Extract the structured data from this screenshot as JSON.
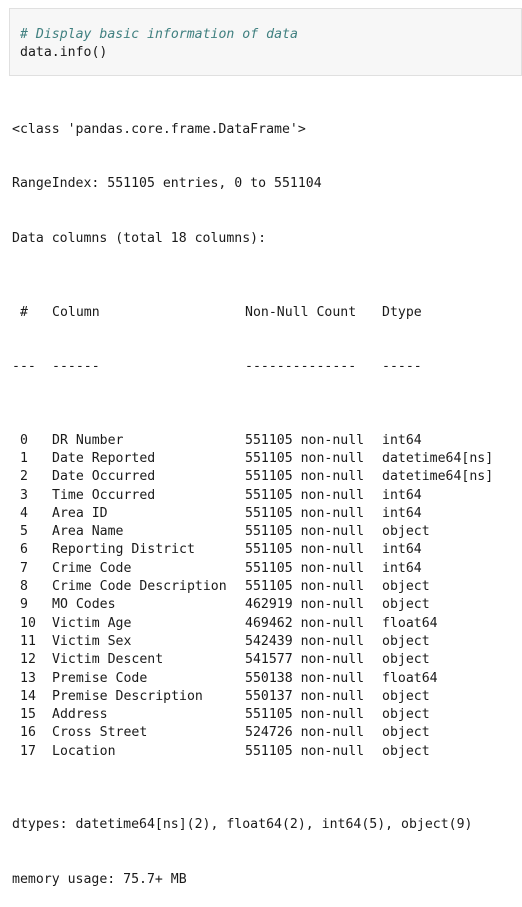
{
  "code_cell": {
    "comment": "# Display basic information of data",
    "code": "data.info()"
  },
  "output": {
    "class_line": "<class 'pandas.core.frame.DataFrame'>",
    "range_index": "RangeIndex: 551105 entries, 0 to 551104",
    "data_columns": "Data columns (total 18 columns):",
    "headers": {
      "idx": "#",
      "column": "Column",
      "count": "Non-Null Count",
      "dtype": "Dtype"
    },
    "separators": {
      "idx": "---",
      "column": "------",
      "count": "--------------",
      "dtype": "-----"
    },
    "rows": [
      {
        "idx": "0",
        "column": "DR Number",
        "count": "551105 non-null",
        "dtype": "int64"
      },
      {
        "idx": "1",
        "column": "Date Reported",
        "count": "551105 non-null",
        "dtype": "datetime64[ns]"
      },
      {
        "idx": "2",
        "column": "Date Occurred",
        "count": "551105 non-null",
        "dtype": "datetime64[ns]"
      },
      {
        "idx": "3",
        "column": "Time Occurred",
        "count": "551105 non-null",
        "dtype": "int64"
      },
      {
        "idx": "4",
        "column": "Area ID",
        "count": "551105 non-null",
        "dtype": "int64"
      },
      {
        "idx": "5",
        "column": "Area Name",
        "count": "551105 non-null",
        "dtype": "object"
      },
      {
        "idx": "6",
        "column": "Reporting District",
        "count": "551105 non-null",
        "dtype": "int64"
      },
      {
        "idx": "7",
        "column": "Crime Code",
        "count": "551105 non-null",
        "dtype": "int64"
      },
      {
        "idx": "8",
        "column": "Crime Code Description",
        "count": "551105 non-null",
        "dtype": "object"
      },
      {
        "idx": "9",
        "column": "MO Codes",
        "count": "462919 non-null",
        "dtype": "object"
      },
      {
        "idx": "10",
        "column": "Victim Age",
        "count": "469462 non-null",
        "dtype": "float64"
      },
      {
        "idx": "11",
        "column": "Victim Sex",
        "count": "542439 non-null",
        "dtype": "object"
      },
      {
        "idx": "12",
        "column": "Victim Descent",
        "count": "541577 non-null",
        "dtype": "object"
      },
      {
        "idx": "13",
        "column": "Premise Code",
        "count": "550138 non-null",
        "dtype": "float64"
      },
      {
        "idx": "14",
        "column": "Premise Description",
        "count": "550137 non-null",
        "dtype": "object"
      },
      {
        "idx": "15",
        "column": "Address",
        "count": "551105 non-null",
        "dtype": "object"
      },
      {
        "idx": "16",
        "column": "Cross Street",
        "count": "524726 non-null",
        "dtype": "object"
      },
      {
        "idx": "17",
        "column": "Location",
        "count": "551105 non-null",
        "dtype": "object"
      }
    ],
    "dtypes_line": "dtypes: datetime64[ns](2), float64(2), int64(5), object(9)",
    "memory_line": "memory usage: 75.7+ MB"
  }
}
